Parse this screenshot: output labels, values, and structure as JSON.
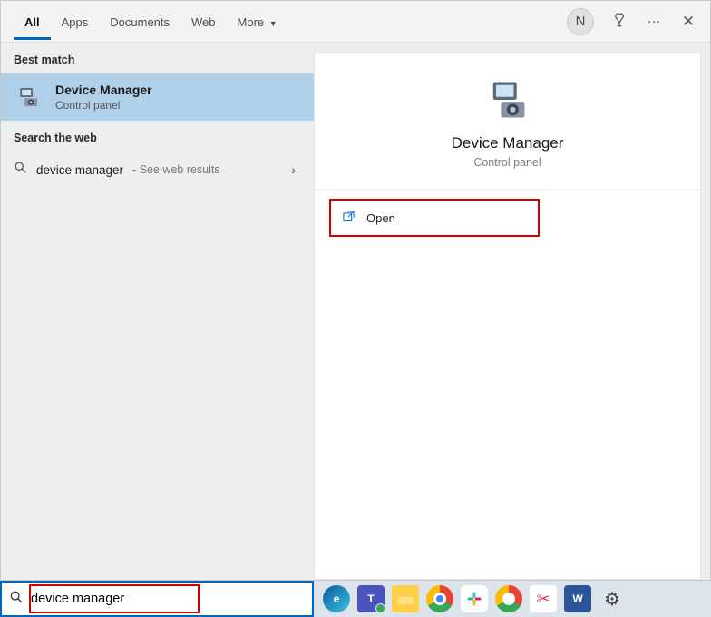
{
  "tabs": {
    "all": "All",
    "apps": "Apps",
    "documents": "Documents",
    "web": "Web",
    "more": "More"
  },
  "avatar_initial": "N",
  "sections": {
    "best_match": "Best match",
    "search_web": "Search the web"
  },
  "best_result": {
    "title": "Device Manager",
    "subtitle": "Control panel"
  },
  "web_result": {
    "query": "device manager",
    "hint": "- See web results"
  },
  "preview": {
    "title": "Device Manager",
    "subtitle": "Control panel",
    "open_label": "Open"
  },
  "search": {
    "value": "device manager"
  }
}
